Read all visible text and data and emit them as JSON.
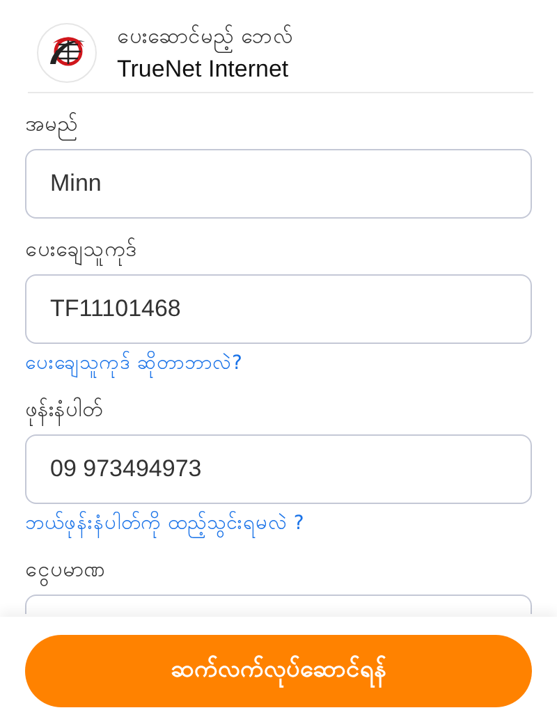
{
  "biller": {
    "caption": "ပေးဆောင်မည့် ဘေလ်",
    "name": "TrueNet Internet"
  },
  "fields": [
    {
      "label": "အမည်",
      "value": "Minn"
    },
    {
      "label": "ပေးချေသူကုဒ်",
      "value": "TF11101468",
      "help_link": "ပေးချေသူကုဒ် ဆိုတာဘာလဲ?"
    },
    {
      "label": "ဖုန်းနံပါတ်",
      "value": "09 973494973",
      "help_link": "ဘယ်ဖုန်းနံပါတ်ကို ထည့်သွင်းရမလဲ ?"
    },
    {
      "label": "ငွေပမာဏ"
    }
  ],
  "primary_button": "ဆက်လက်လုပ်ဆောင်ရန်"
}
